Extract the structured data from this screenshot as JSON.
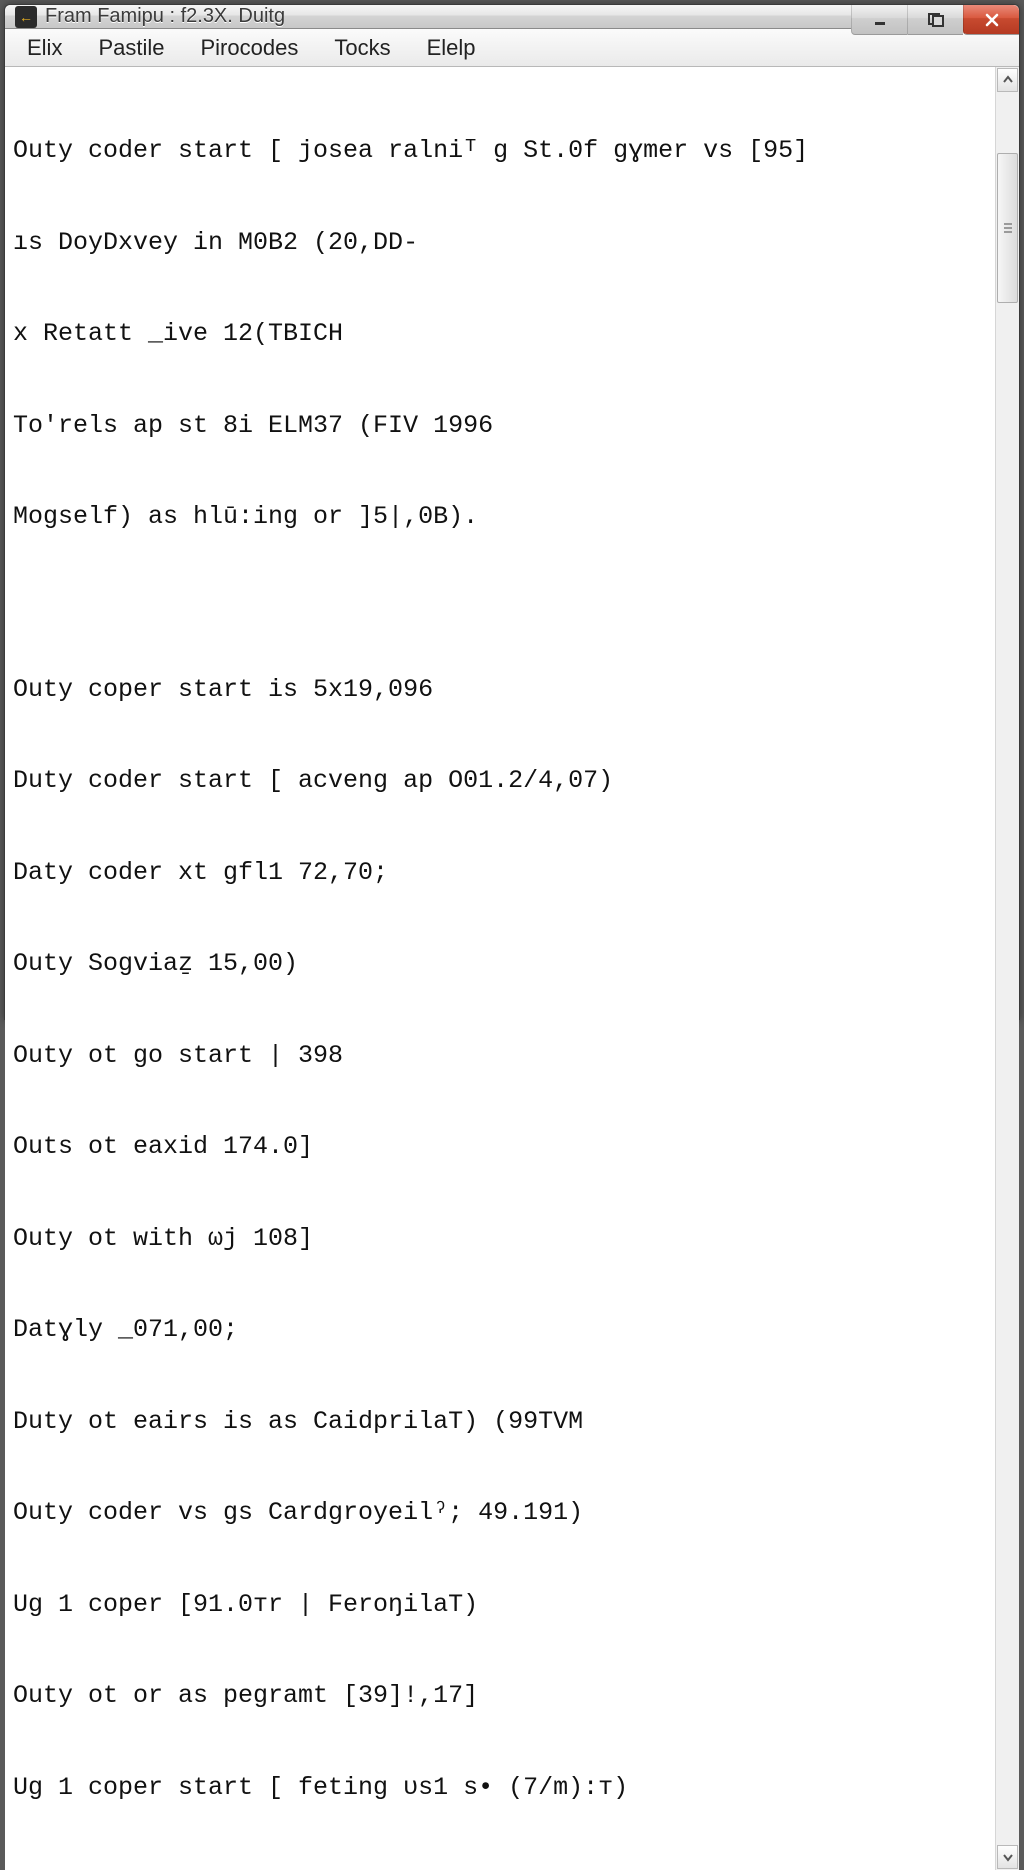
{
  "window": {
    "title": "Fram Famipu : f2.3X. Duitg"
  },
  "menubar": {
    "items": [
      "Elix",
      "Pastile",
      "Pirocodes",
      "Tocks",
      "Elelp"
    ]
  },
  "content": {
    "lines_a": [
      "Outy coder start [ josea ralniᵀ g St.0f gɣmer vs [95]",
      "ıs DoyDxvey in M0B2 (20,DD-",
      "x Retatt _ive 12(TBICH",
      "To'rels ap st 8i ELM37 (FIV 1996",
      "Mogself) as hlū:ing or ]5|,0B)."
    ],
    "lines_b": [
      "Outy coper start is 5x19,096",
      "Duty coder start [ acveng ap O01.2/4,07)",
      "Daty coder xt gfl1 72,70;",
      "Outy Sogviaẕ 15,00)",
      "Outy ot go start | 398",
      "Outs ot eaxid 174.0]",
      "Outy ot with ωj 108]",
      "Datɣly _071,00;",
      "Duty ot eairs is as CaidprilaT) (99TVM",
      "Outy coder vs gs Cardgroyeilˀ; 49.191)",
      "Ug 1 coper [91.0тr | FeroŋilaT)",
      "Outy ot or as peɡramt [39]!,17]",
      "Ug 1 coper start [ feting υs1 s• (7/m):т)"
    ]
  }
}
